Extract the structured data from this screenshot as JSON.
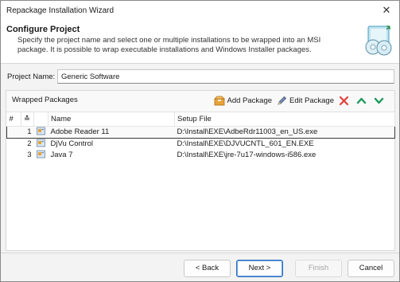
{
  "window": {
    "title": "Repackage Installation Wizard",
    "close_glyph": "✕"
  },
  "header": {
    "title": "Configure Project",
    "description": "Specify the project name and select one or multiple installations to be wrapped into an MSI package. It is possible to wrap executable installations and Windows Installer packages.",
    "icon": "installer-discs-icon"
  },
  "project": {
    "label": "Project Name:",
    "value": "Generic Software"
  },
  "packages": {
    "group_title": "Wrapped Packages",
    "toolbar": {
      "add_label": "Add Package",
      "edit_label": "Edit Package",
      "delete_icon": "delete-x-icon",
      "up_icon": "move-up-icon",
      "down_icon": "move-down-icon"
    },
    "columns": {
      "num": "#",
      "sort": "≛",
      "name": "Name",
      "setup": "Setup File"
    },
    "rows": [
      {
        "num": "1",
        "name": "Adobe Reader 11",
        "setup": "D:\\Install\\EXE\\AdbeRdr11003_en_US.exe"
      },
      {
        "num": "2",
        "name": "DjVu Control",
        "setup": "D:\\Install\\EXE\\DJVUCNTL_601_EN.EXE"
      },
      {
        "num": "3",
        "name": "Java 7",
        "setup": "D:\\Install\\EXE\\jre-7u17-windows-i586.exe"
      }
    ]
  },
  "footer": {
    "back_label": "< Back",
    "next_label": "Next >",
    "finish_label": "Finish",
    "cancel_label": "Cancel"
  },
  "colors": {
    "accent": "#2b6fc2",
    "delete": "#e0403a",
    "arrows": "#1f9a5c",
    "package": "#e8a23a"
  }
}
